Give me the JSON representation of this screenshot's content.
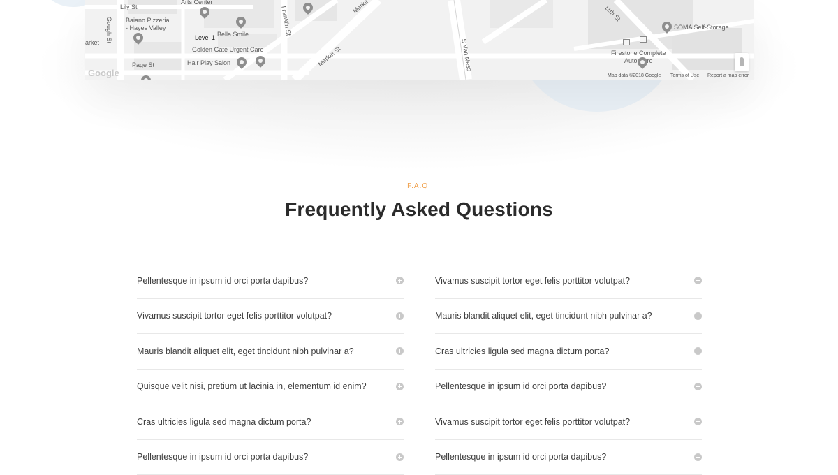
{
  "map": {
    "labels": {
      "lily_st": "Lily St",
      "arts_center": "Arts Center",
      "gough_st": "Gough St",
      "baiano": "Baiano Pizzeria\n- Hayes Valley",
      "market_left": "arket",
      "level1": "Level 1",
      "bella_smile": "Bella Smile",
      "golden_gate": "Golden Gate Urgent Care",
      "page_st": "Page St",
      "hair_play": "Hair Play Salon",
      "franklin_st": "Franklin St",
      "market_st_top": "Marke",
      "market_st": "Market St",
      "s_van_ness": "S Van Ness",
      "eleventh_st": "11th St",
      "soma": "SOMA Self-Storage",
      "firestone": "Firestone Complete\nAuto Care",
      "google": "Google",
      "map_data": "Map data ©2018 Google",
      "terms": "Terms of Use",
      "report": "Report a map error"
    }
  },
  "faq": {
    "eyebrow": "F.A.Q.",
    "title": "Frequently Asked Questions",
    "left": [
      "Pellentesque in ipsum id orci porta dapibus?",
      "Vivamus suscipit tortor eget felis porttitor volutpat?",
      "Mauris blandit aliquet elit, eget tincidunt nibh pulvinar a?",
      "Quisque velit nisi, pretium ut lacinia in, elementum id enim?",
      "Cras ultricies ligula sed magna dictum porta?",
      "Pellentesque in ipsum id orci porta dapibus?"
    ],
    "right": [
      "Vivamus suscipit tortor eget felis porttitor volutpat?",
      "Mauris blandit aliquet elit, eget tincidunt nibh pulvinar a?",
      "Cras ultricies ligula sed magna dictum porta?",
      "Pellentesque in ipsum id orci porta dapibus?",
      "Vivamus suscipit tortor eget felis porttitor volutpat?",
      "Pellentesque in ipsum id orci porta dapibus?"
    ]
  },
  "colors": {
    "accent": "#f0a04b",
    "title": "#2b2b2b",
    "question": "#3d3d3d",
    "divider": "#e8e8e8"
  }
}
